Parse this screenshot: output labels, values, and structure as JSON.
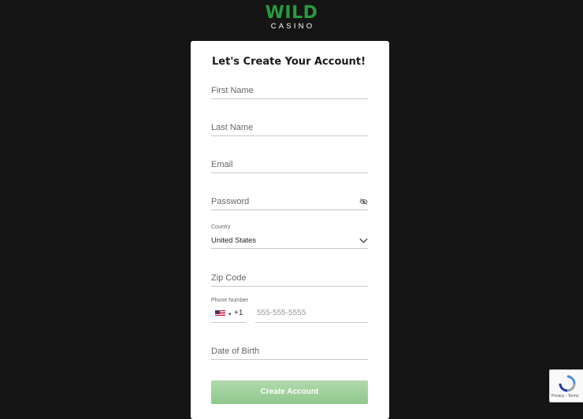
{
  "logo": {
    "wild": "WILD",
    "casino": "CASINO"
  },
  "form": {
    "title": "Let's Create Your Account!",
    "first_name_placeholder": "First Name",
    "last_name_placeholder": "Last Name",
    "email_placeholder": "Email",
    "password_placeholder": "Password",
    "country_label": "Country",
    "country_value": "United States",
    "zip_placeholder": "Zip Code",
    "phone_label": "Phone Number",
    "phone_dial_code": "+1",
    "phone_placeholder": "555-555-5555",
    "dob_placeholder": "Date of Birth",
    "submit_label": "Create Account"
  },
  "recaptcha": {
    "links": "Privacy - Terms"
  },
  "colors": {
    "background": "#151515",
    "brand_green": "#2a9a3c",
    "button_green": "#9fd19b",
    "card": "#ffffff"
  },
  "icons": [
    "eye-off-icon",
    "chevron-down-icon",
    "us-flag-icon",
    "recaptcha-icon"
  ]
}
